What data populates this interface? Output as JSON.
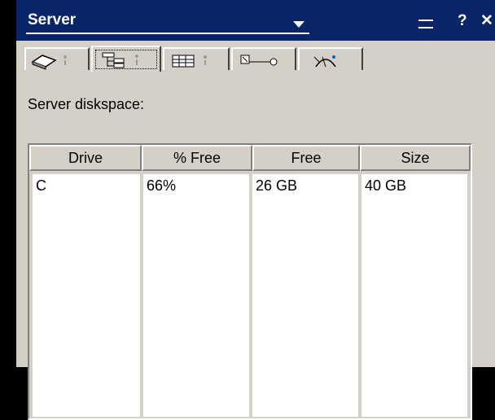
{
  "window": {
    "title": "Server",
    "menu_icon": "minimize-bar-icon",
    "help_label": "?",
    "close_label": "✕"
  },
  "tabs": [
    {
      "icon": "disk-icon"
    },
    {
      "icon": "tree-icon"
    },
    {
      "icon": "grid-icon"
    },
    {
      "icon": "network-icon"
    },
    {
      "icon": "gauge-icon"
    }
  ],
  "content": {
    "label": "Server diskspace:"
  },
  "table": {
    "headers": [
      "Drive",
      "% Free",
      "Free",
      "Size"
    ],
    "rows": [
      [
        "C",
        "66%",
        "26 GB",
        "40 GB"
      ]
    ]
  }
}
